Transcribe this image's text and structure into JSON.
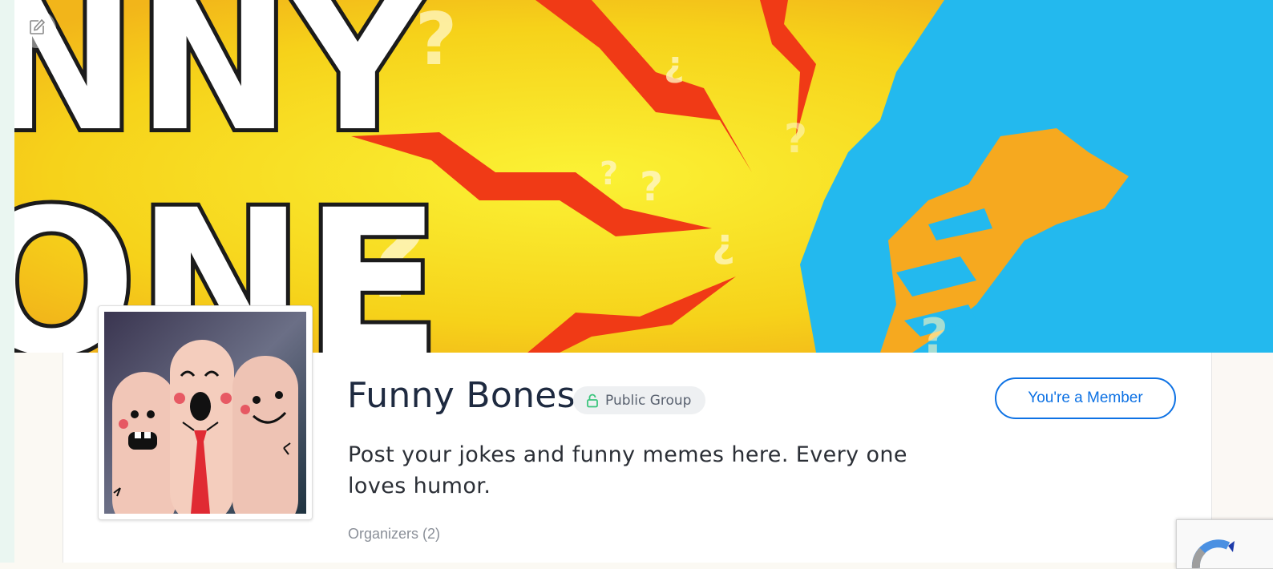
{
  "group": {
    "name": "Funny Bones",
    "visibility": "Public Group",
    "description": "Post your jokes and funny memes here. Every one loves humor.",
    "organizers_label": "Organizers (2)"
  },
  "actions": {
    "membership_label": "You're a Member"
  },
  "icons": {
    "edit": "edit-icon",
    "lock": "lock-open-icon",
    "recaptcha": "recaptcha-logo-icon"
  },
  "colors": {
    "accent": "#0e72e4",
    "title": "#1e2a40",
    "badge_bg": "#eef0f2",
    "lock_icon": "#3cc57d",
    "cover_yellow": "#f6d21a",
    "cover_blue": "#23b9ee",
    "cover_red": "#f03a16"
  }
}
